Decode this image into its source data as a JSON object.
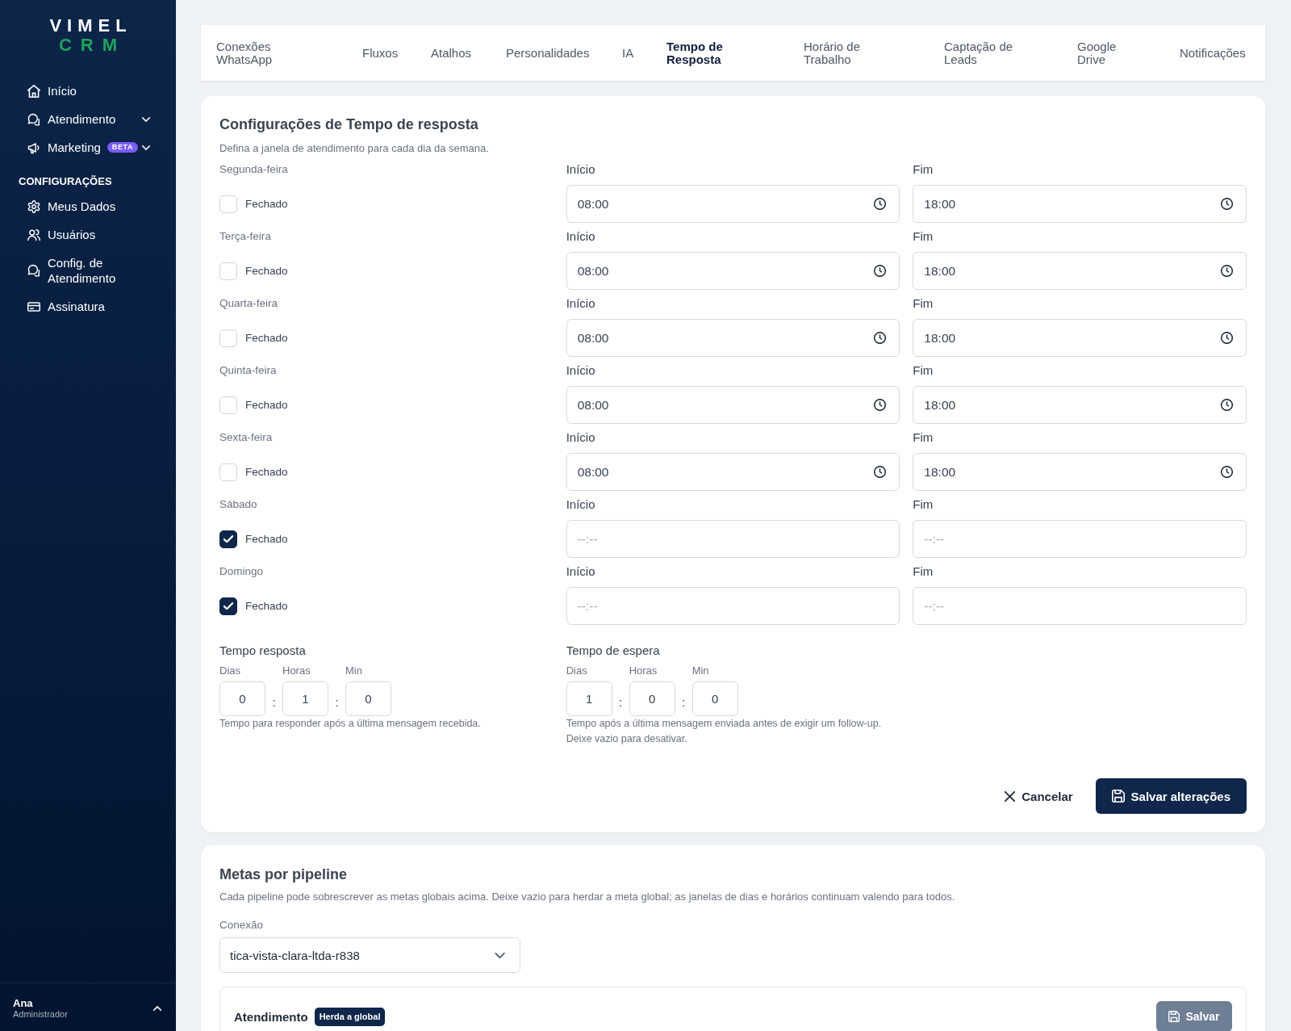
{
  "sidebar": {
    "logo_top": "VIMEL",
    "logo_bottom": "CRM",
    "nav": [
      {
        "label": "Início"
      },
      {
        "label": "Atendimento",
        "expanded": false
      },
      {
        "label": "Marketing",
        "badge": "BETA",
        "expanded": false
      }
    ],
    "section_title": "CONFIGURAÇÕES",
    "settings": [
      {
        "label": "Meus Dados"
      },
      {
        "label": "Usuários"
      },
      {
        "label": "Config. de Atendimento"
      },
      {
        "label": "Assinatura"
      }
    ],
    "user": {
      "name": "Ana",
      "role": "Administrador"
    }
  },
  "tabs": [
    {
      "label": "Conexões WhatsApp",
      "selected": false
    },
    {
      "label": "Fluxos",
      "selected": false
    },
    {
      "label": "Atalhos",
      "selected": false
    },
    {
      "label": "Personalidades",
      "selected": false
    },
    {
      "label": "IA",
      "selected": false
    },
    {
      "label": "Tempo de Resposta",
      "selected": true
    },
    {
      "label": "Horário de Trabalho",
      "selected": false
    },
    {
      "label": "Captação de Leads",
      "selected": false
    },
    {
      "label": "Google Drive",
      "selected": false
    },
    {
      "label": "Notificações",
      "selected": false
    }
  ],
  "response_settings": {
    "title": "Configurações de Tempo de resposta",
    "subtitle": "Defina a janela de atendimento para cada dia da semana.",
    "days": [
      {
        "day": "Segunda-feira",
        "closed_label": "Fechado",
        "checked": false,
        "start_label": "Início",
        "start": {
          "value": "08:00"
        },
        "end_label": "Fim",
        "end": {
          "value": "18:00"
        }
      },
      {
        "day": "Terça-feira",
        "closed_label": "Fechado",
        "checked": false,
        "start_label": "Início",
        "start": {
          "value": "08:00"
        },
        "end_label": "Fim",
        "end": {
          "value": "18:00"
        }
      },
      {
        "day": "Quarta-feira",
        "closed_label": "Fechado",
        "checked": false,
        "start_label": "Início",
        "start": {
          "value": "08:00"
        },
        "end_label": "Fim",
        "end": {
          "value": "18:00"
        }
      },
      {
        "day": "Quinta-feira",
        "closed_label": "Fechado",
        "checked": false,
        "start_label": "Início",
        "start": {
          "value": "08:00"
        },
        "end_label": "Fim",
        "end": {
          "value": "18:00"
        }
      },
      {
        "day": "Sexta-feira",
        "closed_label": "Fechado",
        "checked": false,
        "start_label": "Início",
        "start": {
          "value": "08:00"
        },
        "end_label": "Fim",
        "end": {
          "value": "18:00"
        }
      },
      {
        "day": "Sábado",
        "closed_label": "Fechado",
        "checked": true,
        "start_label": "Início",
        "start": {
          "placeholder": "--:--"
        },
        "end_label": "Fim",
        "end": {
          "placeholder": "--:--"
        }
      },
      {
        "day": "Domingo",
        "closed_label": "Fechado",
        "checked": true,
        "start_label": "Início",
        "start": {
          "placeholder": "--:--"
        },
        "end_label": "Fim",
        "end": {
          "placeholder": "--:--"
        }
      }
    ],
    "timers": [
      {
        "title": "Tempo resposta",
        "fields": [
          {
            "label": "Dias",
            "value": "0"
          },
          {
            "separator": ":",
            "label": "Horas",
            "value": "1"
          },
          {
            "separator": ":",
            "label": "Min",
            "value": "0"
          }
        ],
        "help": [
          "Tempo para responder após a última mensagem recebida."
        ]
      },
      {
        "title": "Tempo de espera",
        "fields": [
          {
            "label": "Dias",
            "value": "1"
          },
          {
            "separator": ":",
            "label": "Horas",
            "value": "0"
          },
          {
            "separator": ":",
            "label": "Min",
            "value": "0"
          }
        ],
        "help": [
          "Tempo após a última mensagem enviada antes de exigir um follow-up.",
          "Deixe vazio para desativar."
        ]
      }
    ],
    "cancel_button": "Cancelar",
    "save_button": "Salvar alterações"
  },
  "pipeline_goals": {
    "title": "Metas por pipeline",
    "description": "Cada pipeline pode sobrescrever as metas globais acima. Deixe vazio para herdar a meta global; as janelas de dias e horários continuam valendo para todos.",
    "connection": {
      "label": "Conexão",
      "value": "tica-vista-clara-ltda-r838"
    },
    "group": {
      "title": "Atendimento",
      "badge": "Herda a global",
      "save_button": {
        "label": "Salvar",
        "disabled": true
      }
    }
  }
}
